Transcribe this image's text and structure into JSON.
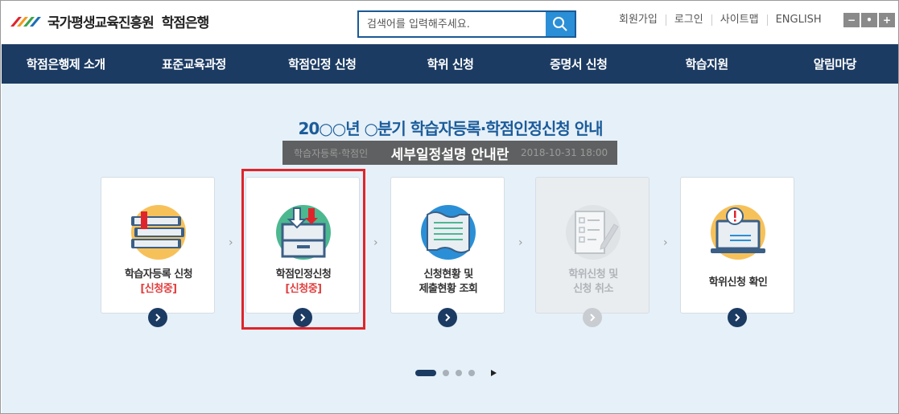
{
  "header": {
    "org_name": "국가평생교육진흥원",
    "service_name": "학점은행",
    "search": {
      "placeholder": "검색어를 입력해주세요."
    },
    "util_links": [
      "회원가입",
      "로그인",
      "사이트맵",
      "ENGLISH"
    ],
    "zoom_controls": [
      "−",
      "•",
      "+"
    ]
  },
  "nav": {
    "items": [
      "학점은행제 소개",
      "표준교육과정",
      "학점인정 신청",
      "학위 신청",
      "증명서 신청",
      "학습지원",
      "알림마당"
    ]
  },
  "banner": {
    "headline": "20○○년 ○분기 학습자등록·학점인정신청 안내",
    "overlay_title": "세부일정설명 안내란",
    "underlay_left": "학습자등록·학점인",
    "underlay_right": "2018-10-31 18:00"
  },
  "steps": [
    {
      "line1": "학습자등록 신청",
      "line2": "[신청중]",
      "icon": "books-icon",
      "enabled": true
    },
    {
      "line1": "학점인정신청",
      "line2": "[신청중]",
      "icon": "inbox-tray-icon",
      "enabled": true
    },
    {
      "line1": "신청현황 및",
      "line2": "제출현황 조회",
      "icon": "document-scroll-icon",
      "enabled": true
    },
    {
      "line1": "학위신청 및",
      "line2": "신청 취소",
      "icon": "checklist-pencil-icon",
      "enabled": false
    },
    {
      "line1": "학위신청 확인",
      "line2": "",
      "icon": "laptop-alert-icon",
      "enabled": true
    }
  ],
  "colors": {
    "nav_bg": "#1c3b63",
    "headline": "#1b5c9a",
    "status_red": "#e04040",
    "highlight_border": "#e0242b",
    "main_bg": "#e6f0f8"
  }
}
